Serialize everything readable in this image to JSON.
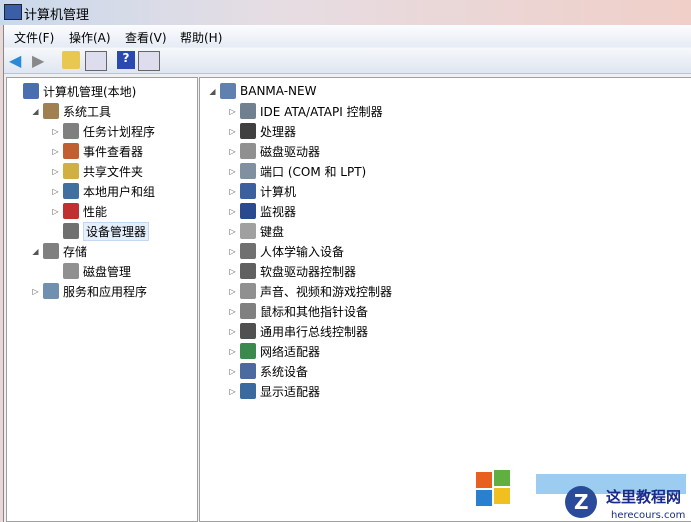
{
  "window": {
    "title": "计算机管理"
  },
  "menu": [
    "文件(F)",
    "操作(A)",
    "查看(V)",
    "帮助(H)"
  ],
  "toolbar": [
    "back-icon",
    "forward-icon",
    "up-folder-icon",
    "show-hide-tree-icon",
    "help-icon",
    "action-pane-icon"
  ],
  "left_tree": [
    {
      "label": "计算机管理(本地)",
      "level": 0,
      "exp": "",
      "icon": "#4a6fb0"
    },
    {
      "label": "系统工具",
      "level": 1,
      "exp": "◢",
      "icon": "#a08050"
    },
    {
      "label": "任务计划程序",
      "level": 2,
      "exp": "▷",
      "icon": "#808080"
    },
    {
      "label": "事件查看器",
      "level": 2,
      "exp": "▷",
      "icon": "#c06030"
    },
    {
      "label": "共享文件夹",
      "level": 2,
      "exp": "▷",
      "icon": "#d0b040"
    },
    {
      "label": "本地用户和组",
      "level": 2,
      "exp": "▷",
      "icon": "#4070a0"
    },
    {
      "label": "性能",
      "level": 2,
      "exp": "▷",
      "icon": "#c03030"
    },
    {
      "label": "设备管理器",
      "level": 2,
      "exp": "",
      "icon": "#707070",
      "selected": true
    },
    {
      "label": "存储",
      "level": 1,
      "exp": "◢",
      "icon": "#808080"
    },
    {
      "label": "磁盘管理",
      "level": 2,
      "exp": "",
      "icon": "#909090"
    },
    {
      "label": "服务和应用程序",
      "level": 1,
      "exp": "▷",
      "icon": "#7090b0"
    }
  ],
  "device_tree": {
    "root": "BANMA-NEW",
    "items": [
      "IDE ATA/ATAPI 控制器",
      "处理器",
      "磁盘驱动器",
      "端口 (COM 和 LPT)",
      "计算机",
      "监视器",
      "键盘",
      "人体学输入设备",
      "软盘驱动器控制器",
      "声音、视频和游戏控制器",
      "鼠标和其他指针设备",
      "通用串行总线控制器",
      "网络适配器",
      "系统设备",
      "显示适配器"
    ]
  },
  "watermark": {
    "name": "这里教程网",
    "url": "herecours.com"
  }
}
